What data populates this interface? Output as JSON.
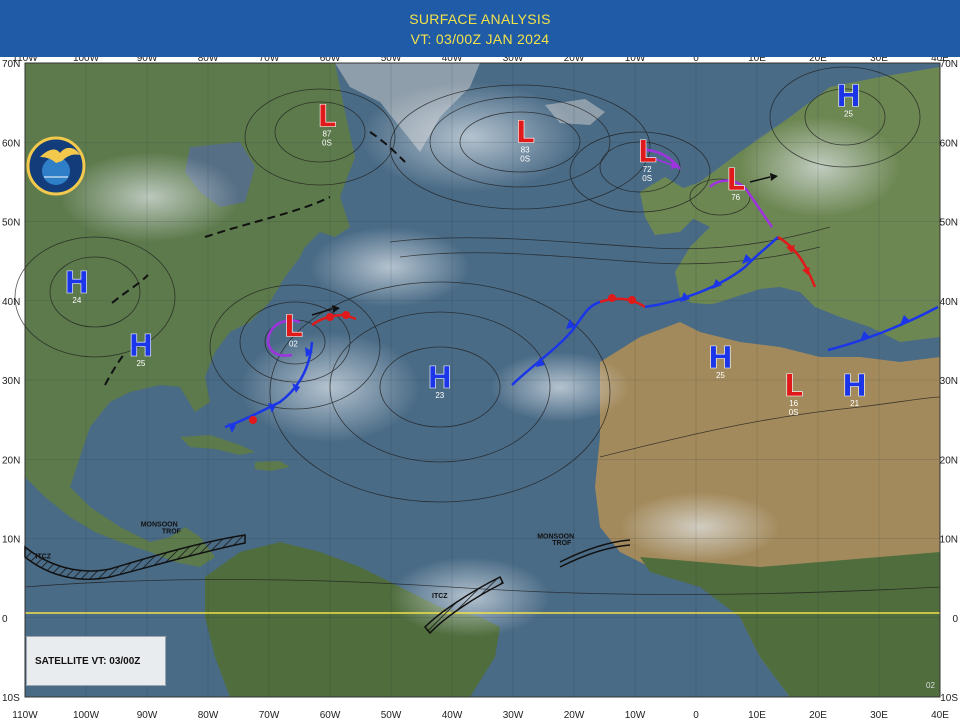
{
  "header": {
    "title": "SURFACE ANALYSIS",
    "valid_time": "VT: 03/00Z JAN 2024"
  },
  "satellite_box": {
    "label": "SATELLITE VT: 03/00Z"
  },
  "logo": {
    "text": "FLEET WEATHER CENTER NORFOLK",
    "icon": "eagle-globe-emblem"
  },
  "corner_code": "02",
  "longitude_labels": [
    "110W",
    "100W",
    "90W",
    "80W",
    "70W",
    "60W",
    "50W",
    "40W",
    "30W",
    "20W",
    "10W",
    "0",
    "10E",
    "20E",
    "30E",
    "40E"
  ],
  "latitude_labels": [
    "70N",
    "60N",
    "50N",
    "40N",
    "30N",
    "20N",
    "10N",
    "0",
    "10S"
  ],
  "colors": {
    "high": "#1a36e8",
    "low": "#e0191b",
    "cold_front": "#1a36e8",
    "warm_front": "#e0191b",
    "occluded": "#a033e0",
    "ocean": "#4a6b86",
    "land_green": "#5e7f47",
    "land_desert": "#a38a5c",
    "equator": "#f2e14a"
  },
  "pressure_systems": [
    {
      "type": "L",
      "value": "87",
      "note": "0S",
      "lon": -60.5,
      "lat": 62
    },
    {
      "type": "L",
      "value": "83",
      "note": "0S",
      "lon": -28,
      "lat": 60
    },
    {
      "type": "L",
      "value": "72",
      "note": "0S",
      "lon": -8,
      "lat": 57.5
    },
    {
      "type": "L",
      "value": "76",
      "note": "",
      "lon": 6.5,
      "lat": 54
    },
    {
      "type": "L",
      "value": "02",
      "note": "",
      "lon": -66,
      "lat": 35.5
    },
    {
      "type": "L",
      "value": "16",
      "note": "0S",
      "lon": 16,
      "lat": 28
    },
    {
      "type": "H",
      "value": "24",
      "note": "",
      "lon": -101.5,
      "lat": 41
    },
    {
      "type": "H",
      "value": "25",
      "note": "",
      "lon": -91,
      "lat": 33
    },
    {
      "type": "H",
      "value": "23",
      "note": "",
      "lon": -42,
      "lat": 29
    },
    {
      "type": "H",
      "value": "25",
      "note": "",
      "lon": 4,
      "lat": 31.5
    },
    {
      "type": "H",
      "value": "21",
      "note": "",
      "lon": 26,
      "lat": 28
    },
    {
      "type": "H",
      "value": "25",
      "note": "",
      "lon": 25,
      "lat": 64.5
    }
  ],
  "annotations": [
    {
      "text": "MONSOON",
      "lon": -88,
      "lat": 11.5
    },
    {
      "text": "TROF",
      "lon": -86,
      "lat": 10.6
    },
    {
      "text": "ITCZ",
      "lon": -107,
      "lat": 7.5
    },
    {
      "text": "MONSOON",
      "lon": -23,
      "lat": 10
    },
    {
      "text": "TROF",
      "lon": -22,
      "lat": 9.2
    },
    {
      "text": "ITCZ",
      "lon": -42,
      "lat": 2.5
    }
  ]
}
